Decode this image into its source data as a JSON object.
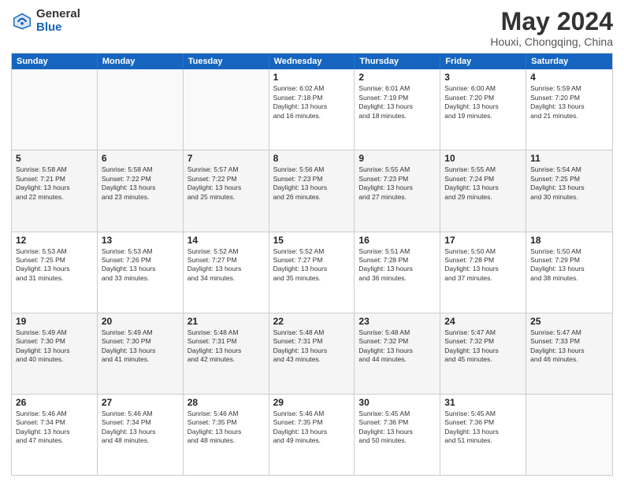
{
  "logo": {
    "general": "General",
    "blue": "Blue"
  },
  "title": "May 2024",
  "subtitle": "Houxi, Chongqing, China",
  "weekdays": [
    "Sunday",
    "Monday",
    "Tuesday",
    "Wednesday",
    "Thursday",
    "Friday",
    "Saturday"
  ],
  "weeks": [
    [
      {
        "day": "",
        "info": ""
      },
      {
        "day": "",
        "info": ""
      },
      {
        "day": "",
        "info": ""
      },
      {
        "day": "1",
        "info": "Sunrise: 6:02 AM\nSunset: 7:18 PM\nDaylight: 13 hours\nand 16 minutes."
      },
      {
        "day": "2",
        "info": "Sunrise: 6:01 AM\nSunset: 7:19 PM\nDaylight: 13 hours\nand 18 minutes."
      },
      {
        "day": "3",
        "info": "Sunrise: 6:00 AM\nSunset: 7:20 PM\nDaylight: 13 hours\nand 19 minutes."
      },
      {
        "day": "4",
        "info": "Sunrise: 5:59 AM\nSunset: 7:20 PM\nDaylight: 13 hours\nand 21 minutes."
      }
    ],
    [
      {
        "day": "5",
        "info": "Sunrise: 5:58 AM\nSunset: 7:21 PM\nDaylight: 13 hours\nand 22 minutes."
      },
      {
        "day": "6",
        "info": "Sunrise: 5:58 AM\nSunset: 7:22 PM\nDaylight: 13 hours\nand 23 minutes."
      },
      {
        "day": "7",
        "info": "Sunrise: 5:57 AM\nSunset: 7:22 PM\nDaylight: 13 hours\nand 25 minutes."
      },
      {
        "day": "8",
        "info": "Sunrise: 5:56 AM\nSunset: 7:23 PM\nDaylight: 13 hours\nand 26 minutes."
      },
      {
        "day": "9",
        "info": "Sunrise: 5:55 AM\nSunset: 7:23 PM\nDaylight: 13 hours\nand 27 minutes."
      },
      {
        "day": "10",
        "info": "Sunrise: 5:55 AM\nSunset: 7:24 PM\nDaylight: 13 hours\nand 29 minutes."
      },
      {
        "day": "11",
        "info": "Sunrise: 5:54 AM\nSunset: 7:25 PM\nDaylight: 13 hours\nand 30 minutes."
      }
    ],
    [
      {
        "day": "12",
        "info": "Sunrise: 5:53 AM\nSunset: 7:25 PM\nDaylight: 13 hours\nand 31 minutes."
      },
      {
        "day": "13",
        "info": "Sunrise: 5:53 AM\nSunset: 7:26 PM\nDaylight: 13 hours\nand 33 minutes."
      },
      {
        "day": "14",
        "info": "Sunrise: 5:52 AM\nSunset: 7:27 PM\nDaylight: 13 hours\nand 34 minutes."
      },
      {
        "day": "15",
        "info": "Sunrise: 5:52 AM\nSunset: 7:27 PM\nDaylight: 13 hours\nand 35 minutes."
      },
      {
        "day": "16",
        "info": "Sunrise: 5:51 AM\nSunset: 7:28 PM\nDaylight: 13 hours\nand 36 minutes."
      },
      {
        "day": "17",
        "info": "Sunrise: 5:50 AM\nSunset: 7:28 PM\nDaylight: 13 hours\nand 37 minutes."
      },
      {
        "day": "18",
        "info": "Sunrise: 5:50 AM\nSunset: 7:29 PM\nDaylight: 13 hours\nand 38 minutes."
      }
    ],
    [
      {
        "day": "19",
        "info": "Sunrise: 5:49 AM\nSunset: 7:30 PM\nDaylight: 13 hours\nand 40 minutes."
      },
      {
        "day": "20",
        "info": "Sunrise: 5:49 AM\nSunset: 7:30 PM\nDaylight: 13 hours\nand 41 minutes."
      },
      {
        "day": "21",
        "info": "Sunrise: 5:48 AM\nSunset: 7:31 PM\nDaylight: 13 hours\nand 42 minutes."
      },
      {
        "day": "22",
        "info": "Sunrise: 5:48 AM\nSunset: 7:31 PM\nDaylight: 13 hours\nand 43 minutes."
      },
      {
        "day": "23",
        "info": "Sunrise: 5:48 AM\nSunset: 7:32 PM\nDaylight: 13 hours\nand 44 minutes."
      },
      {
        "day": "24",
        "info": "Sunrise: 5:47 AM\nSunset: 7:32 PM\nDaylight: 13 hours\nand 45 minutes."
      },
      {
        "day": "25",
        "info": "Sunrise: 5:47 AM\nSunset: 7:33 PM\nDaylight: 13 hours\nand 46 minutes."
      }
    ],
    [
      {
        "day": "26",
        "info": "Sunrise: 5:46 AM\nSunset: 7:34 PM\nDaylight: 13 hours\nand 47 minutes."
      },
      {
        "day": "27",
        "info": "Sunrise: 5:46 AM\nSunset: 7:34 PM\nDaylight: 13 hours\nand 48 minutes."
      },
      {
        "day": "28",
        "info": "Sunrise: 5:46 AM\nSunset: 7:35 PM\nDaylight: 13 hours\nand 48 minutes."
      },
      {
        "day": "29",
        "info": "Sunrise: 5:46 AM\nSunset: 7:35 PM\nDaylight: 13 hours\nand 49 minutes."
      },
      {
        "day": "30",
        "info": "Sunrise: 5:45 AM\nSunset: 7:36 PM\nDaylight: 13 hours\nand 50 minutes."
      },
      {
        "day": "31",
        "info": "Sunrise: 5:45 AM\nSunset: 7:36 PM\nDaylight: 13 hours\nand 51 minutes."
      },
      {
        "day": "",
        "info": ""
      }
    ]
  ]
}
